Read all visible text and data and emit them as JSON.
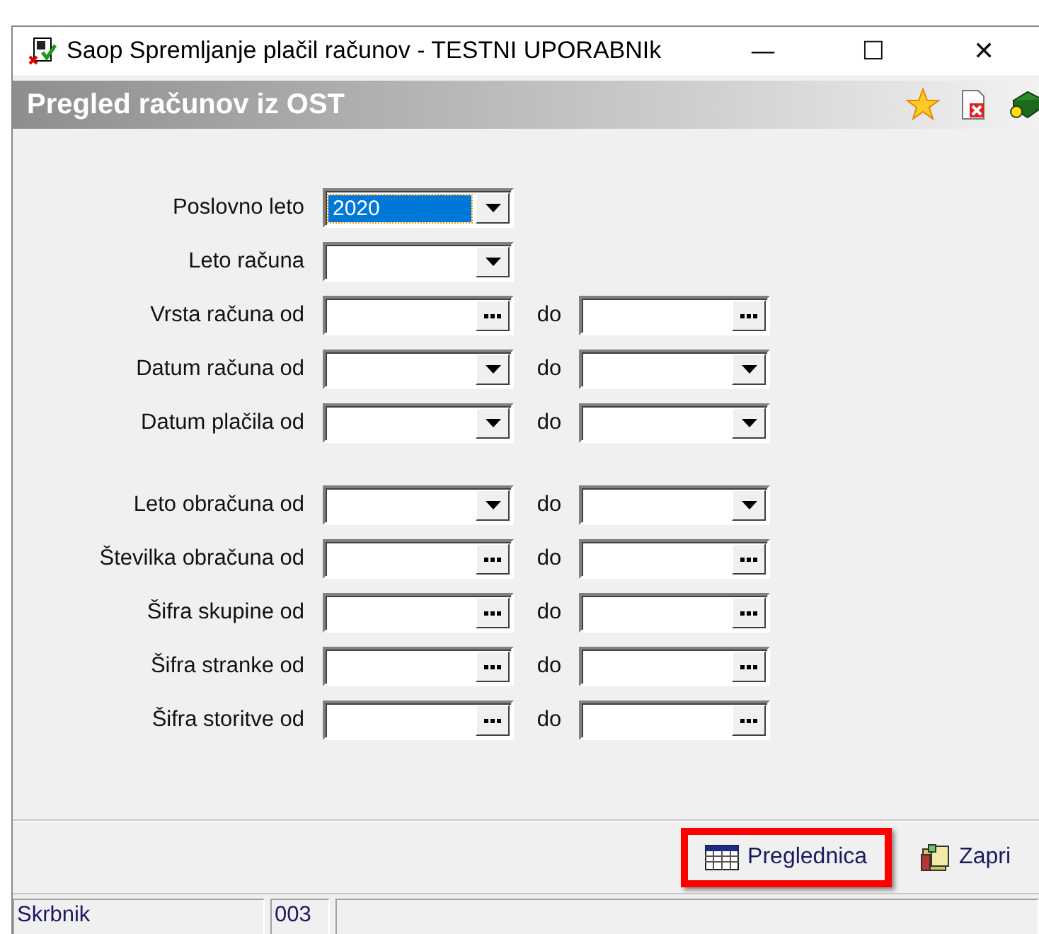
{
  "window": {
    "title": "Saop Spremljanje plačil računov - TESTNI UPORABNIk",
    "controls": [
      "—",
      "☐",
      "✕"
    ]
  },
  "panel": {
    "title": "Pregled računov iz OST"
  },
  "form": {
    "groups": [
      {
        "rows": [
          {
            "label": "Poslovno leto",
            "from": {
              "kind": "dropdown",
              "value": "2020",
              "selected": true
            }
          },
          {
            "label": "Leto računa",
            "from": {
              "kind": "dropdown",
              "selected": false
            }
          },
          {
            "label": "Vrsta računa od",
            "from": {
              "kind": "lookup",
              "selected": false
            },
            "to_label": "do",
            "to": {
              "kind": "lookup",
              "selected": false
            }
          },
          {
            "label": "Datum računa od",
            "from": {
              "kind": "dropdown",
              "selected": false
            },
            "to_label": "do",
            "to": {
              "kind": "dropdown",
              "selected": false
            }
          },
          {
            "label": "Datum plačila od",
            "from": {
              "kind": "dropdown",
              "selected": false
            },
            "to_label": "do",
            "to": {
              "kind": "dropdown",
              "selected": false
            }
          }
        ]
      },
      {
        "rows": [
          {
            "label": "Leto obračuna od",
            "from": {
              "kind": "dropdown",
              "selected": false
            },
            "to_label": "do",
            "to": {
              "kind": "dropdown",
              "selected": false
            }
          },
          {
            "label": "Številka obračuna od",
            "from": {
              "kind": "lookup",
              "selected": false
            },
            "to_label": "do",
            "to": {
              "kind": "lookup",
              "selected": false
            }
          },
          {
            "label": "Šifra skupine od",
            "from": {
              "kind": "lookup",
              "selected": false
            },
            "to_label": "do",
            "to": {
              "kind": "lookup",
              "selected": false
            }
          },
          {
            "label": "Šifra stranke od",
            "from": {
              "kind": "lookup",
              "selected": false
            },
            "to_label": "do",
            "to": {
              "kind": "lookup",
              "selected": false
            }
          },
          {
            "label": "Šifra storitve od",
            "from": {
              "kind": "lookup",
              "selected": false
            },
            "to_label": "do",
            "to": {
              "kind": "lookup",
              "selected": false
            }
          }
        ]
      }
    ]
  },
  "buttons": [
    {
      "label": "Preglednica",
      "kind": "grid",
      "highlighted": true
    },
    {
      "label": "Zapri",
      "kind": "close",
      "highlighted": false
    }
  ],
  "status_bar": [
    "Skrbnik",
    "003"
  ]
}
